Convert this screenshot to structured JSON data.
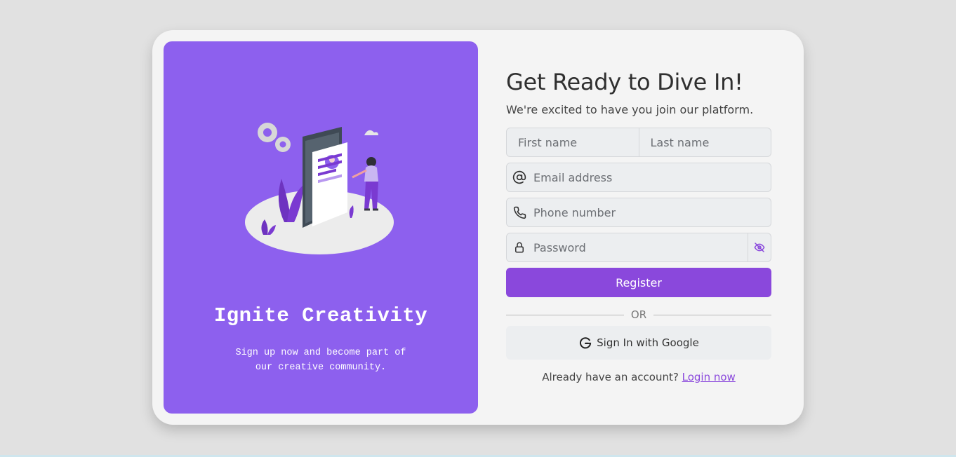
{
  "hero": {
    "title": "Ignite Creativity",
    "subtitle_line1": "Sign up now and become part of",
    "subtitle_line2": "our creative community."
  },
  "form": {
    "heading": "Get Ready to Dive In!",
    "subheading": "We're excited to have you join our platform.",
    "first_name_placeholder": "First name",
    "last_name_placeholder": "Last name",
    "email_placeholder": "Email address",
    "phone_placeholder": "Phone number",
    "password_placeholder": "Password",
    "register_label": "Register",
    "or_label": "OR",
    "google_label": "Sign In with Google",
    "login_prompt": "Already have an account?",
    "login_link": "Login now"
  },
  "icons": {
    "email": "at-icon",
    "phone": "phone-icon",
    "password": "lock-icon",
    "toggle": "eye-off-icon",
    "google": "google-icon"
  },
  "colors": {
    "hero_bg": "#8d60ee",
    "accent": "#8a48dc",
    "page_bg": "#e1e1e1",
    "card_bg": "#f4f4f4"
  }
}
